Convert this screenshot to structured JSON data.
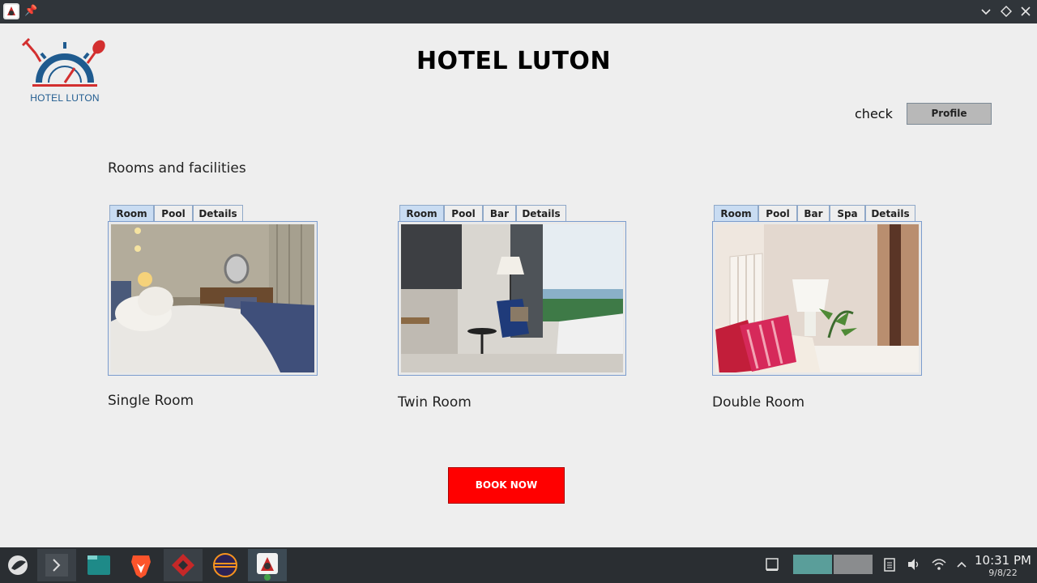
{
  "window": {
    "controls": {
      "minimize_icon": "chevron-down-icon",
      "maximize_icon": "diamond-icon",
      "close_icon": "close-icon"
    }
  },
  "header": {
    "logo_text": "HOTEL LUTON",
    "title": "HOTEL LUTON",
    "check_label": "check",
    "profile_button": "Profile"
  },
  "main": {
    "section_heading": "Rooms and facilities",
    "rooms": [
      {
        "name": "Single Room",
        "tabs": [
          "Room",
          "Pool",
          "Details"
        ],
        "active_tab": "Room"
      },
      {
        "name": "Twin Room",
        "tabs": [
          "Room",
          "Pool",
          "Bar",
          "Details"
        ],
        "active_tab": "Room"
      },
      {
        "name": "Double Room",
        "tabs": [
          "Room",
          "Pool",
          "Bar",
          "Spa",
          "Details"
        ],
        "active_tab": "Room"
      }
    ],
    "book_button": "BOOK NOW"
  },
  "taskbar": {
    "apps": [
      "app-launcher-icon",
      "terminal-icon",
      "file-manager-icon",
      "brave-browser-icon",
      "red-app-icon",
      "eclipse-icon",
      "java-app-icon"
    ],
    "tray": [
      "show-desktop-icon",
      "clipboard-icon",
      "volume-icon",
      "wifi-icon",
      "tray-expand-icon"
    ],
    "clock": {
      "time": "10:31 PM",
      "date": "9/8/22"
    }
  },
  "colors": {
    "accent_red": "#ff0000",
    "tab_active": "#c9dcf2",
    "logo_blue": "#1f5b8f"
  }
}
